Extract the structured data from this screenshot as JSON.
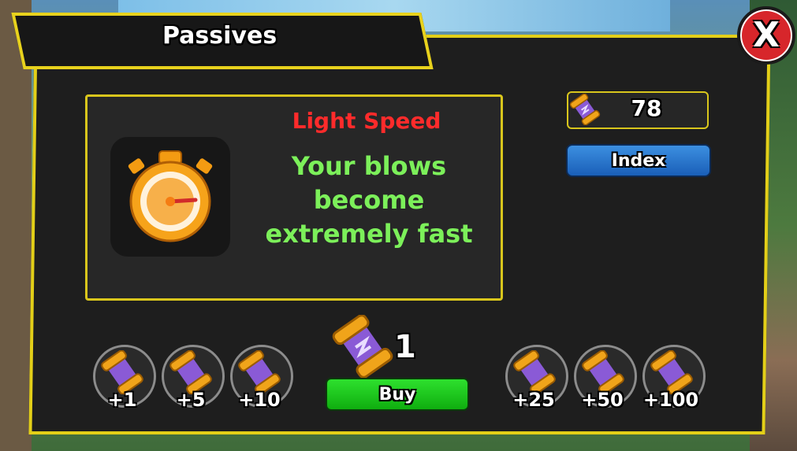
{
  "window": {
    "title": "Passives",
    "close_label": "X"
  },
  "passive": {
    "name": "Light Speed",
    "description_lines": [
      "Your blows",
      "become",
      "extremely fast"
    ],
    "icon": "stopwatch-icon"
  },
  "currency": {
    "icon": "scroll-icon",
    "value": "78"
  },
  "index_button": {
    "label": "Index"
  },
  "purchase": {
    "icon": "scroll-icon",
    "quantity": "1",
    "buy_label": "Buy",
    "amounts": [
      "+1",
      "+5",
      "+10",
      "+25",
      "+50",
      "+100"
    ]
  },
  "colors": {
    "panel_border": "#e3cf18",
    "name_color": "#ff2b2b",
    "description_color": "#7cf05a",
    "buy_button": "#1fc41f",
    "index_button": "#2a78d0",
    "close_button": "#d7262b"
  }
}
